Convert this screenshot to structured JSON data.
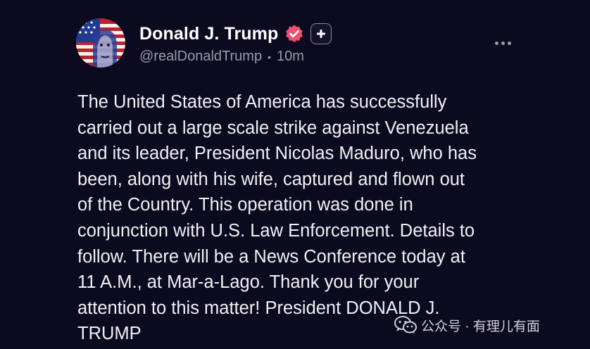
{
  "post": {
    "display_name": "Donald J. Trump",
    "handle": "@realDonaldTrump",
    "separator": "•",
    "time_ago": "10m",
    "body_lines": [
      "The United States of America has successfully",
      "carried out a large scale strike against Venezuela",
      "and its leader, President Nicolas Maduro, who has",
      "been, along with his wife, captured and flown out",
      "of the Country. This operation was done in",
      "conjunction with U.S. Law Enforcement. Details to",
      "follow. There will be a News Conference today at",
      "11 A.M., at Mar-a-Lago. Thank you for your",
      "attention to this matter! President DONALD J.",
      "TRUMP"
    ]
  },
  "watermark": {
    "text": "公众号 · 有理儿有面"
  },
  "icons": {
    "verified": "verified-badge-icon",
    "plus": "plus-icon",
    "more": "more-dots-icon",
    "watermark": "wechat-icon"
  },
  "colors": {
    "background": "#0c0a1f",
    "verified_badge": "#f0506e",
    "secondary_text": "#9b9aa8",
    "primary_text": "#f1f1f4"
  }
}
